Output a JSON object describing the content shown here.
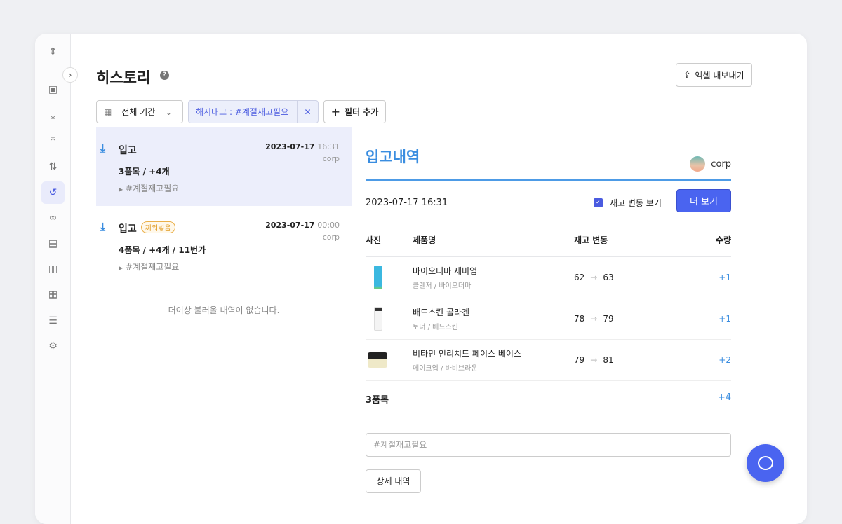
{
  "page": {
    "title": "히스토리",
    "export_label": "엑셀 내보내기"
  },
  "filters": {
    "period": "전체 기간",
    "tag": "해시태그 : #계절재고필요",
    "add": "필터 추가"
  },
  "list": {
    "items": [
      {
        "type": "입고",
        "badge": null,
        "date": "2023-07-17",
        "time": "16:31",
        "user": "corp",
        "summary": "3품목 / +4개",
        "hashtag": "#계절재고필요"
      },
      {
        "type": "입고",
        "badge": "끼워넣음",
        "date": "2023-07-17",
        "time": "00:00",
        "user": "corp",
        "summary": "4품목 / +4개 / 11번가",
        "hashtag": "#계절재고필요"
      }
    ],
    "empty": "더이상 불러올 내역이 없습니다."
  },
  "detail": {
    "title": "입고내역",
    "user": "corp",
    "datetime": "2023-07-17 16:31",
    "show_changes_label": "재고 변동 보기",
    "show_changes_checked": true,
    "more_label": "더 보기",
    "columns": [
      "사진",
      "제품명",
      "재고 변동",
      "수량"
    ],
    "rows": [
      {
        "name": "바이오더마 세비엄",
        "sub": "클렌저 / 바이오더마",
        "from": "62",
        "to": "63",
        "qty": "+1"
      },
      {
        "name": "배드스킨 콜라겐",
        "sub": "토너 / 배드스킨",
        "from": "78",
        "to": "79",
        "qty": "+1"
      },
      {
        "name": "비타민 인리치드 페이스 베이스",
        "sub": "메이크업 / 바비브라운",
        "from": "79",
        "to": "81",
        "qty": "+2"
      }
    ],
    "total_label": "3품목",
    "total_qty": "+4",
    "hashtag_value": "#계절재고필요",
    "detail_label": "상세 내역"
  },
  "colors": {
    "accent": "#4a64f0",
    "blue": "#3a8de0",
    "badge": "#e09a20"
  }
}
